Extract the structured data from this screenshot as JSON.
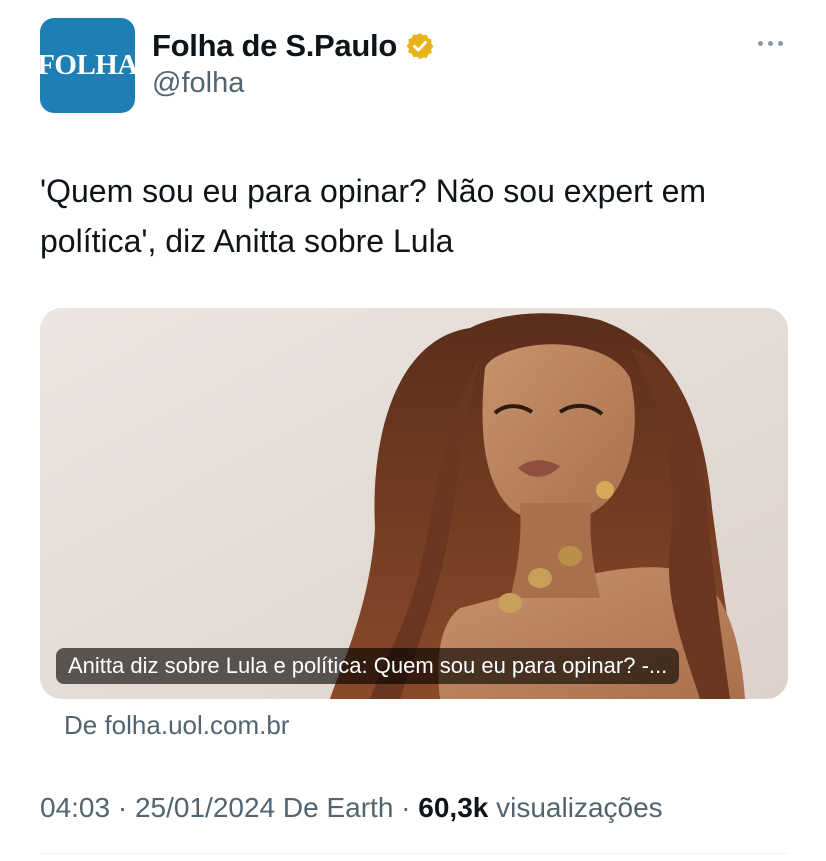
{
  "account": {
    "avatar_text": "FOLHA",
    "display_name": "Folha de S.Paulo",
    "handle": "@folha",
    "verified_icon": "verified-gold-badge",
    "avatar_color": "#1d7fb4",
    "badge_color": "#e8b21c"
  },
  "tweet": {
    "text": "'Quem sou eu para opinar? Não sou expert em política', diz Anitta sobre Lula"
  },
  "card": {
    "caption": "Anitta diz sobre Lula e política: Quem sou eu para opinar? -...",
    "source": "De folha.uol.com.br"
  },
  "meta": {
    "time": "04:03",
    "separator1": " · ",
    "date": "25/01/2024",
    "client": " De Earth",
    "separator2": " · ",
    "views_count": "60,3k",
    "views_label": " visualizações"
  }
}
